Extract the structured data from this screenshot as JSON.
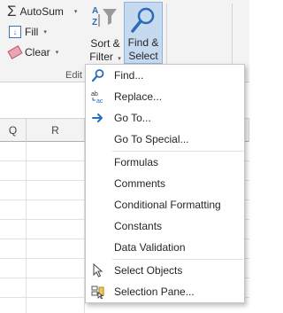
{
  "ribbon": {
    "autosum_label": "AutoSum",
    "fill_label": "Fill",
    "clear_label": "Clear",
    "sort_filter_line1": "Sort &",
    "sort_filter_line2": "Filter",
    "find_select_line1": "Find &",
    "find_select_line2": "Select",
    "group_label": "Edit",
    "dropdown_arrow": "▾"
  },
  "columns": [
    {
      "label": "Q"
    },
    {
      "label": "R"
    }
  ],
  "menu": {
    "items": [
      {
        "label": "Find...",
        "icon": "find-icon"
      },
      {
        "label": "Replace...",
        "icon": "replace-icon"
      },
      {
        "label": "Go To...",
        "icon": "goto-arrow-icon"
      },
      {
        "label": "Go To Special...",
        "icon": ""
      },
      {
        "label": "Formulas",
        "icon": ""
      },
      {
        "label": "Comments",
        "icon": ""
      },
      {
        "label": "Conditional Formatting",
        "icon": ""
      },
      {
        "label": "Constants",
        "icon": ""
      },
      {
        "label": "Data Validation",
        "icon": ""
      },
      {
        "label": "Select Objects",
        "icon": "cursor-icon"
      },
      {
        "label": "Selection Pane...",
        "icon": "selection-pane-icon"
      }
    ]
  },
  "colors": {
    "accent": "#2b6cb8",
    "find_select_active": "#c5d9ef"
  }
}
